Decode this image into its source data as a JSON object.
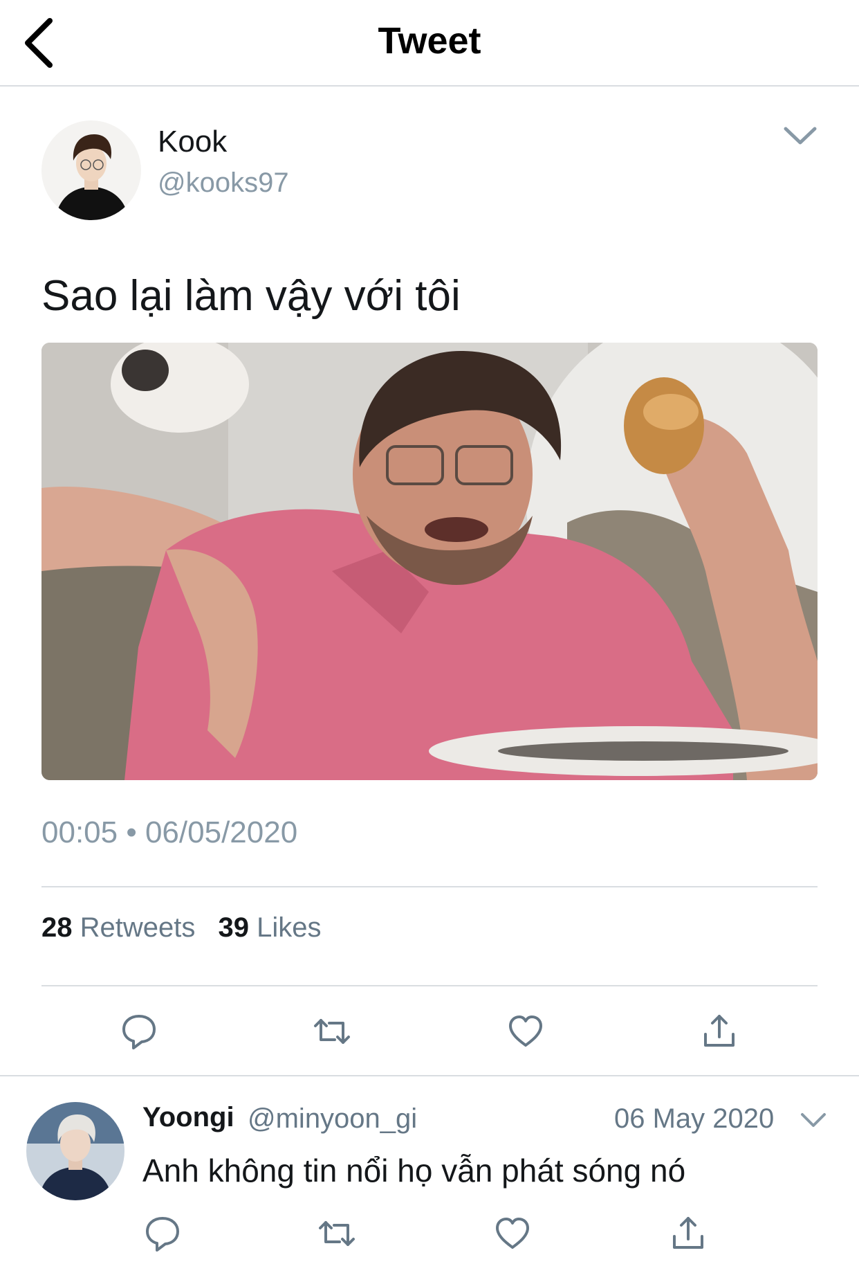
{
  "header": {
    "title": "Tweet"
  },
  "tweet": {
    "display_name": "Kook",
    "handle": "@kooks97",
    "text": "Sao lại làm vậy với tôi",
    "timestamp": "00:05 • 06/05/2020",
    "retweet_count": "28",
    "retweet_label": "Retweets",
    "like_count": "39",
    "like_label": "Likes"
  },
  "reply": {
    "display_name": "Yoongi",
    "handle": "@minyoon_gi",
    "date": "06 May 2020",
    "text": "Anh không tin nổi họ vẫn phát sóng nó"
  },
  "icons": {
    "back": "chevron-left-icon",
    "caret": "chevron-down-icon",
    "reply": "speech-bubble-icon",
    "retweet": "retweet-icon",
    "like": "heart-icon",
    "share": "share-upload-icon"
  },
  "colors": {
    "secondary_text": "#8899a6",
    "icon": "#657786",
    "divider": "#d9dde1"
  }
}
